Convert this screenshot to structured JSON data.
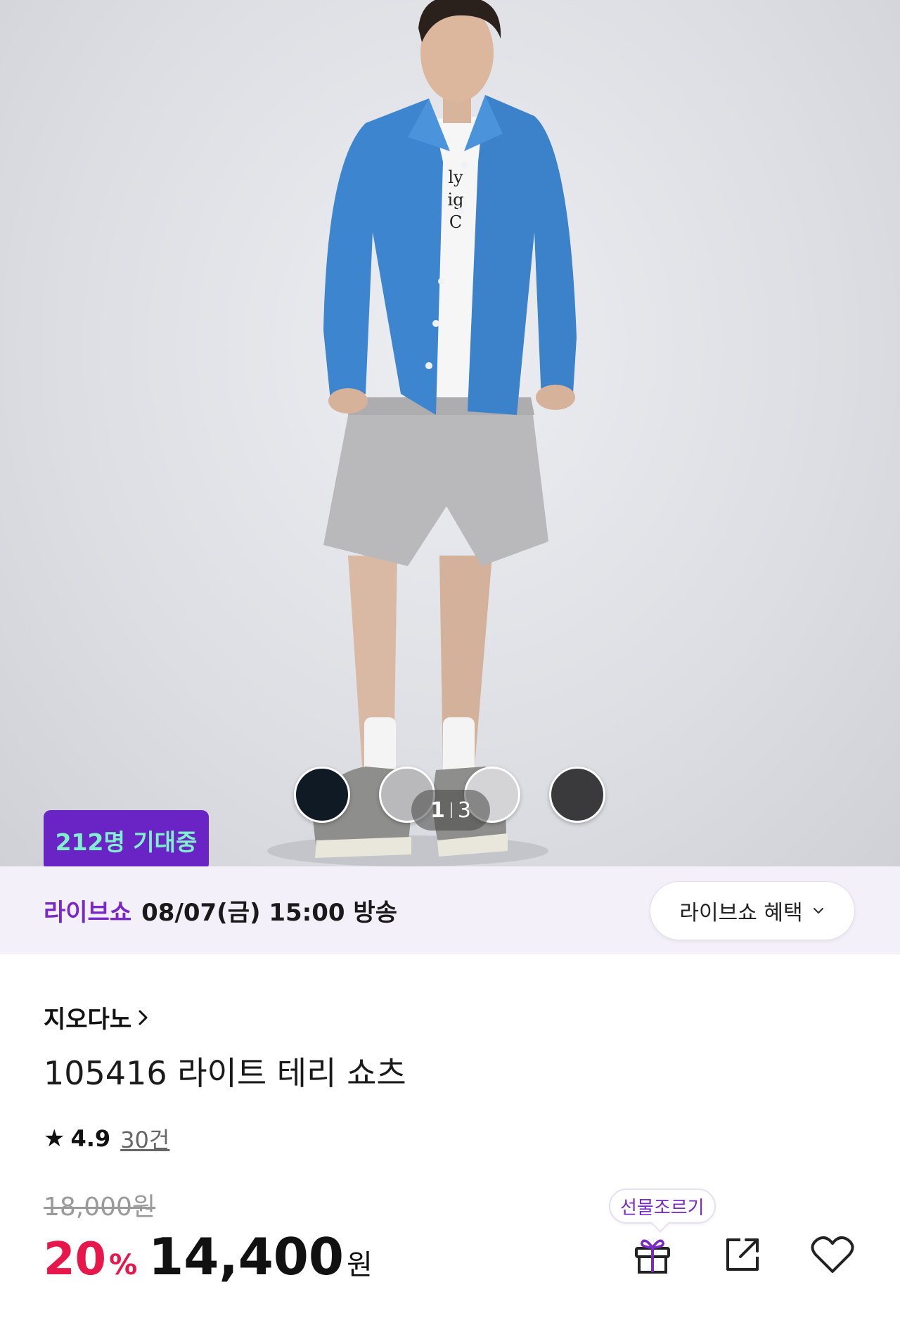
{
  "product_image": {
    "alt_icon": "model-photo",
    "swatch_colors": [
      "#0f1a24",
      "#b9b9bb",
      "#d4d4d6",
      "#3a3a3c"
    ]
  },
  "pager": {
    "current": "1",
    "total": "3"
  },
  "live_badge": {
    "text": "212명 기대중",
    "bg": "#6a23c4",
    "fg": "#7ff0cb"
  },
  "live_show": {
    "label": "라이브쇼",
    "schedule": "08/07(금) 15:00 방송",
    "benefit_button": "라이브쇼 혜택"
  },
  "product": {
    "brand": "지오다노",
    "title": "105416 라이트 테리 쇼츠",
    "rating": "4.9",
    "review_count": "30건",
    "original_price": "18,000원",
    "discount": "20",
    "discount_unit": "%",
    "price": "14,400",
    "price_unit": "원"
  },
  "actions": {
    "gift_tooltip": "선물조르기",
    "gift_icon": "gift-icon",
    "share_icon": "share-icon",
    "wishlist_icon": "heart-icon"
  },
  "colors": {
    "accent_purple": "#7a29c9",
    "discount_red": "#e8174b"
  }
}
